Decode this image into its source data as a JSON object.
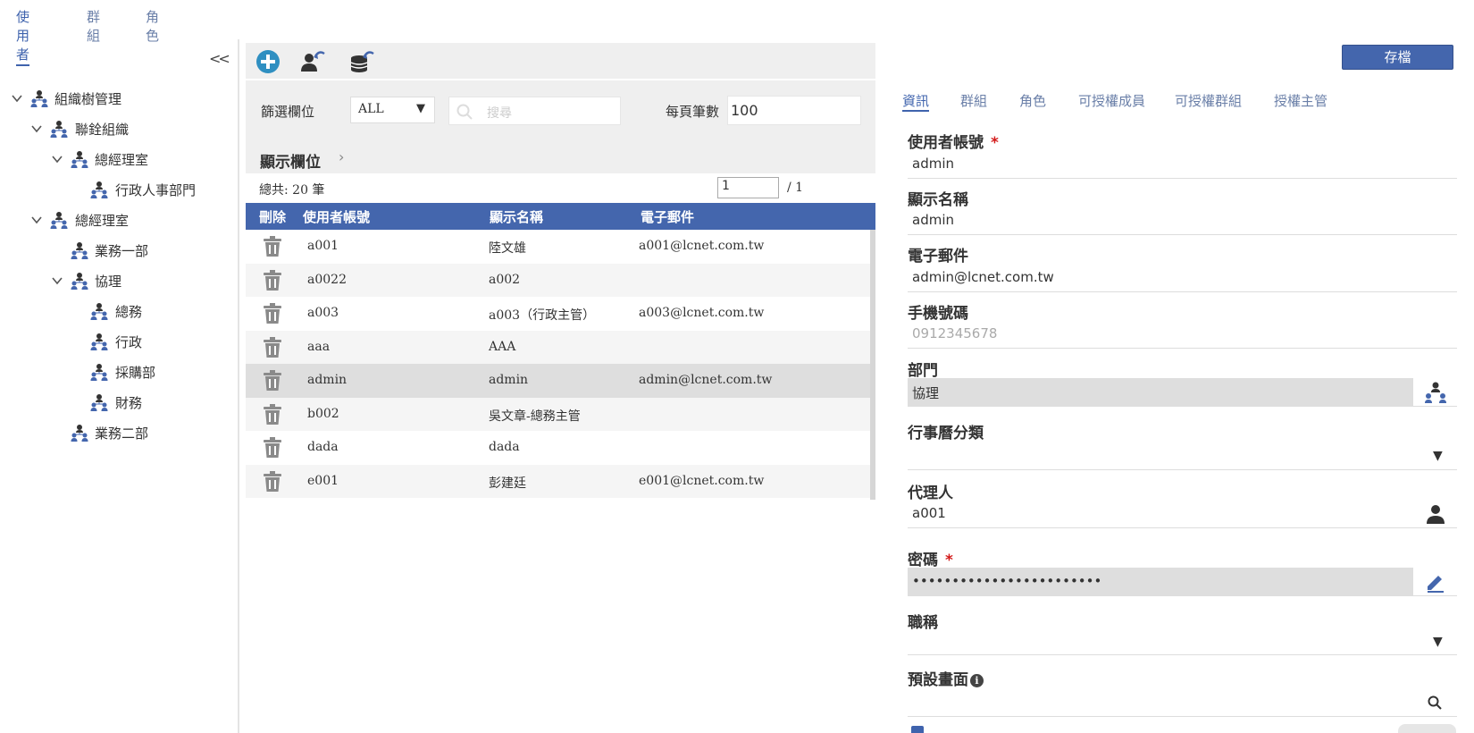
{
  "top_tabs": [
    {
      "label": "使用者",
      "active": true
    },
    {
      "label": "群組",
      "active": false
    },
    {
      "label": "角色",
      "active": false
    }
  ],
  "tree": {
    "collapse_label": "<<",
    "nodes": [
      {
        "label": "組織樹管理",
        "expanded": true
      },
      {
        "label": "聯銓組織",
        "expanded": true
      },
      {
        "label": "總經理室",
        "expanded": true
      },
      {
        "label": "行政人事部門",
        "expanded": null
      },
      {
        "label": "總經理室",
        "expanded": true
      },
      {
        "label": "業務一部",
        "expanded": null
      },
      {
        "label": "協理",
        "expanded": true
      },
      {
        "label": "總務",
        "expanded": null
      },
      {
        "label": "行政",
        "expanded": null
      },
      {
        "label": "採購部",
        "expanded": null
      },
      {
        "label": "財務",
        "expanded": null
      },
      {
        "label": "業務二部",
        "expanded": null
      }
    ]
  },
  "toolbar": {
    "icons": [
      "add-circle-icon",
      "user-import-icon",
      "database-import-icon"
    ]
  },
  "filter": {
    "label": "篩選欄位",
    "selected": "ALL",
    "search_placeholder": "搜尋",
    "page_size_label": "每頁筆數",
    "page_size": "100"
  },
  "display_columns_label": "顯示欄位",
  "pagination": {
    "total_label": "總共: 20 筆",
    "current_page": "1",
    "total_pages": "/  1"
  },
  "grid": {
    "headers": [
      "刪除",
      "使用者帳號",
      "顯示名稱",
      "電子郵件"
    ],
    "rows": [
      {
        "account": "a001",
        "name": "陸文雄",
        "email": "a001@lcnet.com.tw",
        "selected": false
      },
      {
        "account": "a0022",
        "name": "a002",
        "email": "",
        "selected": false
      },
      {
        "account": "a003",
        "name": "a003（行政主管）",
        "email": "a003@lcnet.com.tw",
        "selected": false
      },
      {
        "account": "aaa",
        "name": "AAA",
        "email": "",
        "selected": false
      },
      {
        "account": "admin",
        "name": "admin",
        "email": "admin@lcnet.com.tw",
        "selected": true
      },
      {
        "account": "b002",
        "name": "吳文章-總務主管",
        "email": "",
        "selected": false
      },
      {
        "account": "dada",
        "name": "dada",
        "email": "",
        "selected": false
      },
      {
        "account": "e001",
        "name": "彭建廷",
        "email": "e001@lcnet.com.tw",
        "selected": false
      }
    ]
  },
  "right": {
    "save_label": "存檔",
    "tabs": [
      {
        "label": "資訊",
        "active": true
      },
      {
        "label": "群組",
        "active": false
      },
      {
        "label": "角色",
        "active": false
      },
      {
        "label": "可授權成員",
        "active": false
      },
      {
        "label": "可授權群組",
        "active": false
      },
      {
        "label": "授權主管",
        "active": false
      }
    ],
    "fields": {
      "account_label": "使用者帳號",
      "account_value": "admin",
      "display_name_label": "顯示名稱",
      "display_name_value": "admin",
      "email_label": "電子郵件",
      "email_value": "admin@lcnet.com.tw",
      "mobile_label": "手機號碼",
      "mobile_placeholder": "0912345678",
      "dept_label": "部門",
      "dept_value": "協理",
      "calendar_label": "行事曆分類",
      "calendar_value": "",
      "agent_label": "代理人",
      "agent_value": "a001",
      "password_label": "密碼",
      "password_value": "••••••••••••••••••••••••",
      "title_label": "職稱",
      "title_value": "",
      "default_page_label": "預設畫面"
    },
    "required_mark": "*"
  },
  "colors": {
    "accent": "#4466ad",
    "required": "#d31a1a"
  }
}
